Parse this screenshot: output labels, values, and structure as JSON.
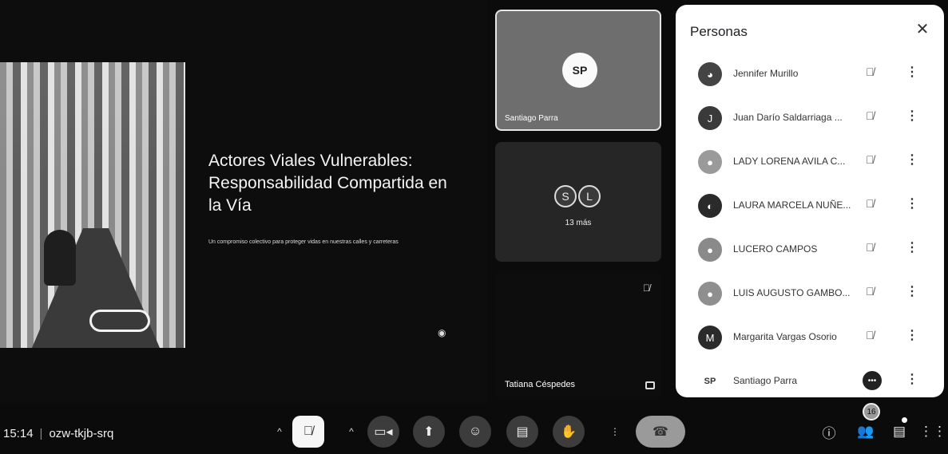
{
  "slide": {
    "title": "Actores Viales Vulnerables: Responsabilidad Compartida en la Vía",
    "subtitle": "Un compromiso colectivo para proteger vidas en nuestras calles y carreteras"
  },
  "tiles": {
    "active": {
      "name": "Santiago Parra",
      "avatar_text": "SP"
    },
    "group": {
      "avatars": [
        "S",
        "L"
      ],
      "more_label": "13 más"
    },
    "bottom": {
      "name": "Tatiana Céspedes"
    }
  },
  "panel": {
    "title": "Personas",
    "close_icon": "close-icon",
    "people": [
      {
        "name": "Jennifer Murillo",
        "avatar": "",
        "status": "muted"
      },
      {
        "name": "Juan Darío Saldarriaga ...",
        "avatar": "J",
        "status": "muted"
      },
      {
        "name": "LADY LORENA AVILA C...",
        "avatar": "",
        "status": "muted"
      },
      {
        "name": "LAURA MARCELA NUÑE...",
        "avatar": "",
        "status": "muted"
      },
      {
        "name": "LUCERO CAMPOS",
        "avatar": "",
        "status": "muted"
      },
      {
        "name": "LUIS AUGUSTO GAMBO...",
        "avatar": "",
        "status": "muted"
      },
      {
        "name": "Margarita Vargas Osorio",
        "avatar": "M",
        "status": "muted"
      },
      {
        "name": "Santiago Parra",
        "avatar": "SP",
        "status": "speaking"
      }
    ]
  },
  "bottom_bar": {
    "time": "15:14",
    "meeting_code": "ozw-tkjb-srq",
    "participants_count": "16"
  }
}
